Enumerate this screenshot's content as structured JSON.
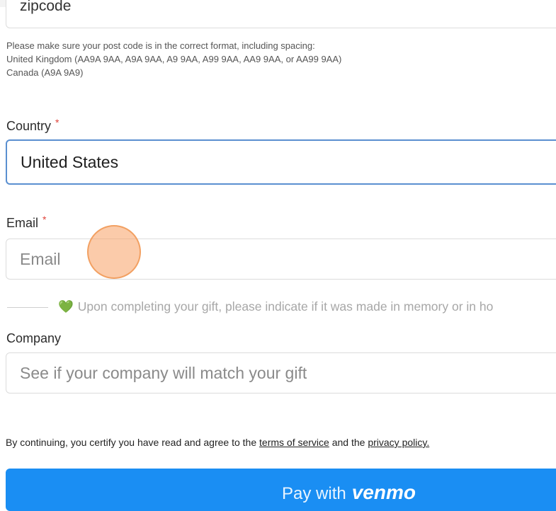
{
  "zipcode": {
    "value": "zipcode"
  },
  "postcode_help": {
    "line1": "Please make sure your post code is in the correct format, including spacing:",
    "line2": "United Kingdom (AA9A 9AA, A9A 9AA, A9 9AA, A99 9AA, AA9 9AA, or AA99 9AA)",
    "line3": "Canada (A9A 9A9)"
  },
  "country": {
    "label": "Country",
    "required_mark": "*",
    "value": "United States"
  },
  "email": {
    "label": "Email",
    "required_mark": "*",
    "placeholder": "Email"
  },
  "memory_note": {
    "text": "Upon completing your gift, please indicate if it was made in memory or in ho"
  },
  "company": {
    "label": "Company",
    "placeholder": "See if your company will match your gift"
  },
  "legal": {
    "prefix": "By continuing, you certify you have read and agree to the",
    "terms_link": "terms of service",
    "middle": "and the",
    "privacy_link": "privacy policy."
  },
  "pay_button": {
    "label": "Pay with",
    "brand": "venmo"
  },
  "icons": {
    "heart": "heart-icon"
  },
  "colors": {
    "accent": "#1a8ef3",
    "required": "#e0433a",
    "focus_border": "#5a8fd0"
  }
}
